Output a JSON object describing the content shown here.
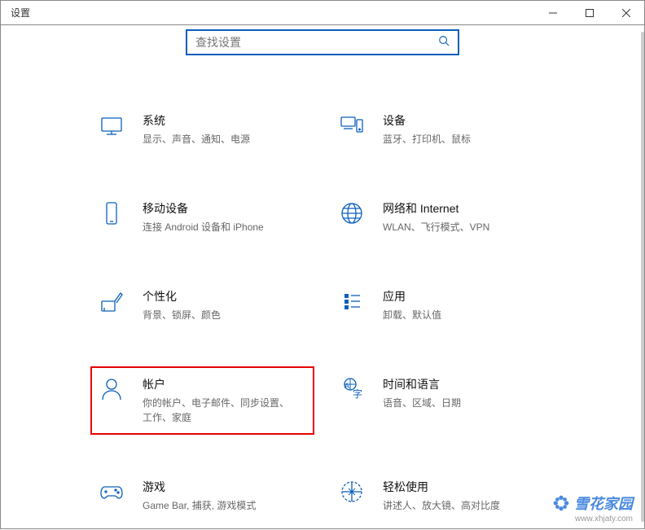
{
  "titlebar": {
    "title": "设置"
  },
  "search": {
    "placeholder": "查找设置"
  },
  "categories": [
    {
      "key": "system",
      "icon": "display-icon",
      "title": "系统",
      "desc": "显示、声音、通知、电源"
    },
    {
      "key": "devices",
      "icon": "devices-icon",
      "title": "设备",
      "desc": "蓝牙、打印机、鼠标"
    },
    {
      "key": "phone",
      "icon": "phone-icon",
      "title": "移动设备",
      "desc": "连接 Android 设备和 iPhone"
    },
    {
      "key": "network",
      "icon": "globe-icon",
      "title": "网络和 Internet",
      "desc": "WLAN、飞行模式、VPN"
    },
    {
      "key": "personalization",
      "icon": "brush-icon",
      "title": "个性化",
      "desc": "背景、锁屏、颜色"
    },
    {
      "key": "apps",
      "icon": "apps-icon",
      "title": "应用",
      "desc": "卸载、默认值"
    },
    {
      "key": "accounts",
      "icon": "person-icon",
      "title": "帐户",
      "desc": "你的帐户、电子邮件、同步设置、工作、家庭",
      "highlight": true
    },
    {
      "key": "time",
      "icon": "language-icon",
      "title": "时间和语言",
      "desc": "语音、区域、日期"
    },
    {
      "key": "gaming",
      "icon": "gamepad-icon",
      "title": "游戏",
      "desc": "Game Bar, 捕获, 游戏模式"
    },
    {
      "key": "accessibility",
      "icon": "access-icon",
      "title": "轻松使用",
      "desc": "讲述人、放大镜、高对比度"
    }
  ],
  "watermark": {
    "brand": "雪花家园",
    "url": "www.xhjaty.com"
  }
}
